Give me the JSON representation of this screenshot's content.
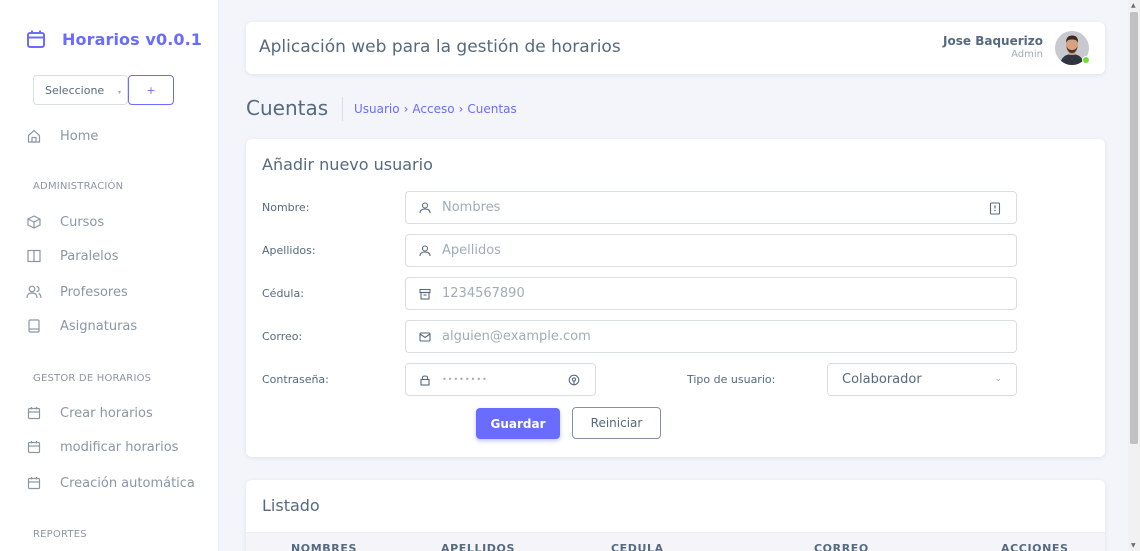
{
  "sidebar": {
    "brand": "Horarios v0.0.1",
    "selector": {
      "value": "Seleccione",
      "add_label": "+"
    },
    "home": "Home",
    "sections": [
      {
        "header": "ADMINISTRACIÓN",
        "items": [
          "Cursos",
          "Paralelos",
          "Profesores",
          "Asignaturas"
        ]
      },
      {
        "header": "GESTOR DE HORARIOS",
        "items": [
          "Crear horarios",
          "modificar horarios",
          "Creación automática"
        ]
      },
      {
        "header": "REPORTES",
        "items": []
      }
    ]
  },
  "header": {
    "title": "Aplicación web para la gestión de horarios",
    "user_name": "Jose Baquerizo",
    "user_role": "Admin"
  },
  "page": {
    "title": "Cuentas",
    "breadcrumb": [
      "Usuario",
      "›",
      "Acceso",
      "›",
      "Cuentas"
    ]
  },
  "form": {
    "title": "Añadir nuevo usuario",
    "fields": {
      "nombre": {
        "label": "Nombre:",
        "placeholder": "Nombres"
      },
      "apellidos": {
        "label": "Apellidos:",
        "placeholder": "Apellidos"
      },
      "cedula": {
        "label": "Cédula:",
        "placeholder": "1234567890"
      },
      "correo": {
        "label": "Correo:",
        "placeholder": "alguien@example.com"
      },
      "contrasena": {
        "label": "Contraseña:",
        "placeholder": "••••••••"
      },
      "tipo": {
        "label": "Tipo de usuario:",
        "value": "Colaborador"
      }
    },
    "save_label": "Guardar",
    "reset_label": "Reiniciar"
  },
  "list": {
    "title": "Listado",
    "columns": [
      "NOMBRES",
      "APELLIDOS",
      "CEDULA",
      "CORREO",
      "ACCIONES"
    ]
  },
  "colors": {
    "primary": "#696cff",
    "online": "#71dd37",
    "text": "#566a7f",
    "muted": "#8b96a4",
    "background": "#f4f5fa"
  }
}
